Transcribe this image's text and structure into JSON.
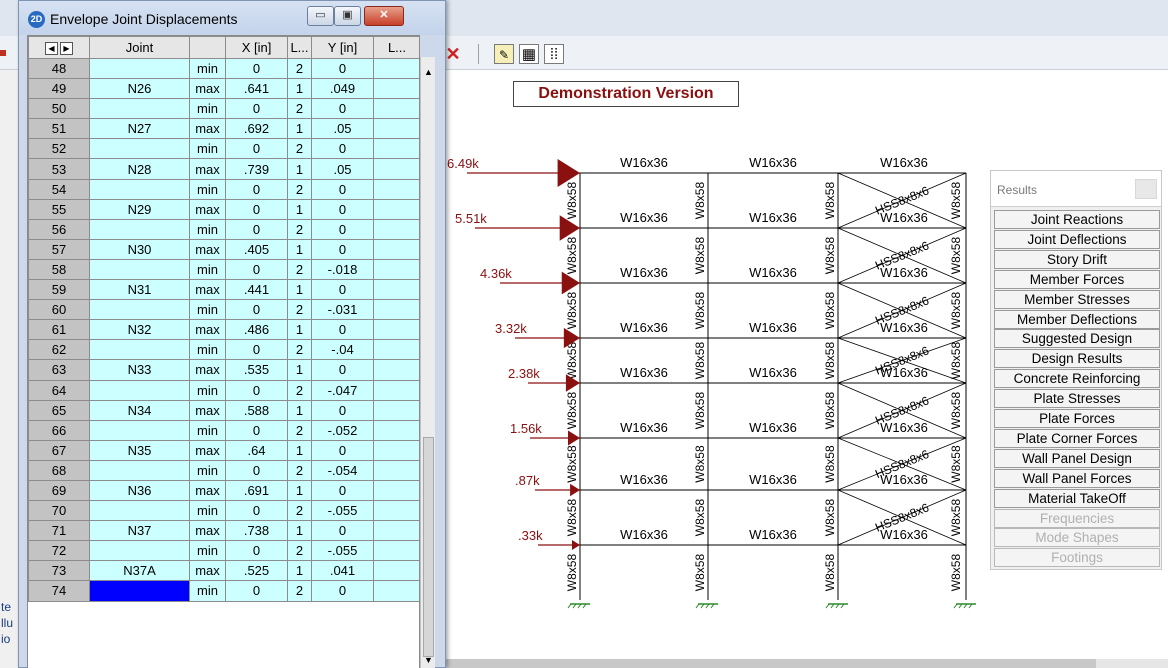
{
  "window": {
    "title": "Envelope Joint Displacements",
    "icon_label": "2D",
    "controls": {
      "minimize": "▭",
      "maximize": "▣",
      "close": "✕"
    }
  },
  "grid": {
    "headers": [
      "Joint",
      "",
      "X [in]",
      "L...",
      "Y [in]",
      "L..."
    ],
    "rows": [
      {
        "n": "48",
        "joint": "",
        "type": "min",
        "x": "0",
        "lx": "2",
        "y": "0"
      },
      {
        "n": "49",
        "joint": "N26",
        "type": "max",
        "x": ".641",
        "lx": "1",
        "y": ".049"
      },
      {
        "n": "50",
        "joint": "",
        "type": "min",
        "x": "0",
        "lx": "2",
        "y": "0"
      },
      {
        "n": "51",
        "joint": "N27",
        "type": "max",
        "x": ".692",
        "lx": "1",
        "y": ".05"
      },
      {
        "n": "52",
        "joint": "",
        "type": "min",
        "x": "0",
        "lx": "2",
        "y": "0"
      },
      {
        "n": "53",
        "joint": "N28",
        "type": "max",
        "x": ".739",
        "lx": "1",
        "y": ".05"
      },
      {
        "n": "54",
        "joint": "",
        "type": "min",
        "x": "0",
        "lx": "2",
        "y": "0"
      },
      {
        "n": "55",
        "joint": "N29",
        "type": "max",
        "x": "0",
        "lx": "1",
        "y": "0"
      },
      {
        "n": "56",
        "joint": "",
        "type": "min",
        "x": "0",
        "lx": "2",
        "y": "0"
      },
      {
        "n": "57",
        "joint": "N30",
        "type": "max",
        "x": ".405",
        "lx": "1",
        "y": "0"
      },
      {
        "n": "58",
        "joint": "",
        "type": "min",
        "x": "0",
        "lx": "2",
        "y": "-.018"
      },
      {
        "n": "59",
        "joint": "N31",
        "type": "max",
        "x": ".441",
        "lx": "1",
        "y": "0"
      },
      {
        "n": "60",
        "joint": "",
        "type": "min",
        "x": "0",
        "lx": "2",
        "y": "-.031"
      },
      {
        "n": "61",
        "joint": "N32",
        "type": "max",
        "x": ".486",
        "lx": "1",
        "y": "0"
      },
      {
        "n": "62",
        "joint": "",
        "type": "min",
        "x": "0",
        "lx": "2",
        "y": "-.04"
      },
      {
        "n": "63",
        "joint": "N33",
        "type": "max",
        "x": ".535",
        "lx": "1",
        "y": "0"
      },
      {
        "n": "64",
        "joint": "",
        "type": "min",
        "x": "0",
        "lx": "2",
        "y": "-.047"
      },
      {
        "n": "65",
        "joint": "N34",
        "type": "max",
        "x": ".588",
        "lx": "1",
        "y": "0"
      },
      {
        "n": "66",
        "joint": "",
        "type": "min",
        "x": "0",
        "lx": "2",
        "y": "-.052"
      },
      {
        "n": "67",
        "joint": "N35",
        "type": "max",
        "x": ".64",
        "lx": "1",
        "y": "0"
      },
      {
        "n": "68",
        "joint": "",
        "type": "min",
        "x": "0",
        "lx": "2",
        "y": "-.054"
      },
      {
        "n": "69",
        "joint": "N36",
        "type": "max",
        "x": ".691",
        "lx": "1",
        "y": "0"
      },
      {
        "n": "70",
        "joint": "",
        "type": "min",
        "x": "0",
        "lx": "2",
        "y": "-.055"
      },
      {
        "n": "71",
        "joint": "N37",
        "type": "max",
        "x": ".738",
        "lx": "1",
        "y": "0"
      },
      {
        "n": "72",
        "joint": "",
        "type": "min",
        "x": "0",
        "lx": "2",
        "y": "-.055"
      },
      {
        "n": "73",
        "joint": "N37A",
        "type": "max",
        "x": ".525",
        "lx": "1",
        "y": ".041"
      },
      {
        "n": "74",
        "joint": "",
        "type": "min",
        "x": "0",
        "lx": "2",
        "y": "0"
      }
    ]
  },
  "banner": "Demonstration Version",
  "model": {
    "beam_label": "W16x36",
    "column_label": "W8x58",
    "brace_label": "HSS8x8x6",
    "loads": [
      "6.49k",
      "5.51k",
      "4.36k",
      "3.32k",
      "2.38k",
      "1.56k",
      ".87k",
      ".33k"
    ]
  },
  "results": {
    "title": "Results",
    "items": [
      {
        "label": "Joint Reactions",
        "enabled": true
      },
      {
        "label": "Joint Deflections",
        "enabled": true
      },
      {
        "label": "Story Drift",
        "enabled": true
      },
      {
        "label": "Member Forces",
        "enabled": true
      },
      {
        "label": "Member Stresses",
        "enabled": true
      },
      {
        "label": "Member Deflections",
        "enabled": true
      },
      {
        "label": "Suggested Design",
        "enabled": true
      },
      {
        "label": "Design Results",
        "enabled": true
      },
      {
        "label": "Concrete Reinforcing",
        "enabled": true
      },
      {
        "label": "Plate Stresses",
        "enabled": true
      },
      {
        "label": "Plate Forces",
        "enabled": true
      },
      {
        "label": "Plate Corner Forces",
        "enabled": true
      },
      {
        "label": "Wall Panel Design",
        "enabled": true
      },
      {
        "label": "Wall Panel Forces",
        "enabled": true
      },
      {
        "label": "Material TakeOff",
        "enabled": true
      },
      {
        "label": "Frequencies",
        "enabled": false
      },
      {
        "label": "Mode Shapes",
        "enabled": false
      },
      {
        "label": "Footings",
        "enabled": false
      }
    ]
  },
  "left_fragments": [
    "te",
    "llu",
    "io"
  ],
  "colors": {
    "load": "#8b1010",
    "cell": "#ccffff",
    "selected": "#0000ff",
    "demo_text": "#8a1010"
  }
}
